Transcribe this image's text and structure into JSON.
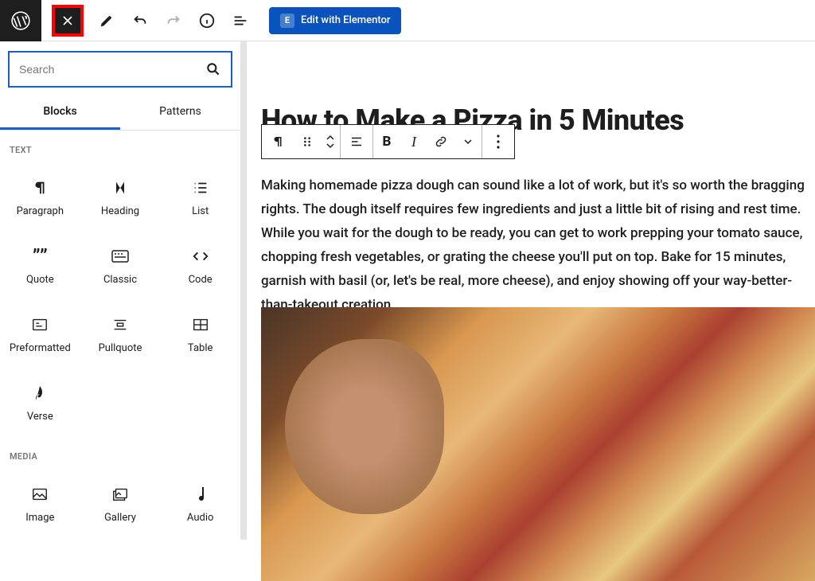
{
  "topbar": {
    "elementor_label": "Edit with Elementor"
  },
  "sidebar": {
    "search_placeholder": "Search",
    "tabs": {
      "blocks": "Blocks",
      "patterns": "Patterns"
    },
    "sections": {
      "text": {
        "title": "TEXT",
        "items": [
          {
            "label": "Paragraph"
          },
          {
            "label": "Heading"
          },
          {
            "label": "List"
          },
          {
            "label": "Quote"
          },
          {
            "label": "Classic"
          },
          {
            "label": "Code"
          },
          {
            "label": "Preformatted"
          },
          {
            "label": "Pullquote"
          },
          {
            "label": "Table"
          },
          {
            "label": "Verse"
          }
        ]
      },
      "media": {
        "title": "MEDIA",
        "items": [
          {
            "label": "Image"
          },
          {
            "label": "Gallery"
          },
          {
            "label": "Audio"
          }
        ]
      }
    }
  },
  "editor": {
    "post_title": "How to Make a Pizza in 5 Minutes",
    "paragraph": "Making homemade pizza dough can sound like a lot of work, but it's so worth the bragging rights. The dough itself requires few ingredients and just a little bit of rising and rest time. While you wait for the dough to be ready, you can get to work prepping your tomato sauce, chopping fresh vegetables, or grating the cheese you'll put on top. Bake for 15 minutes, garnish with basil (or, let's be real, more cheese), and enjoy showing off your way-better-than-takeout creation."
  }
}
